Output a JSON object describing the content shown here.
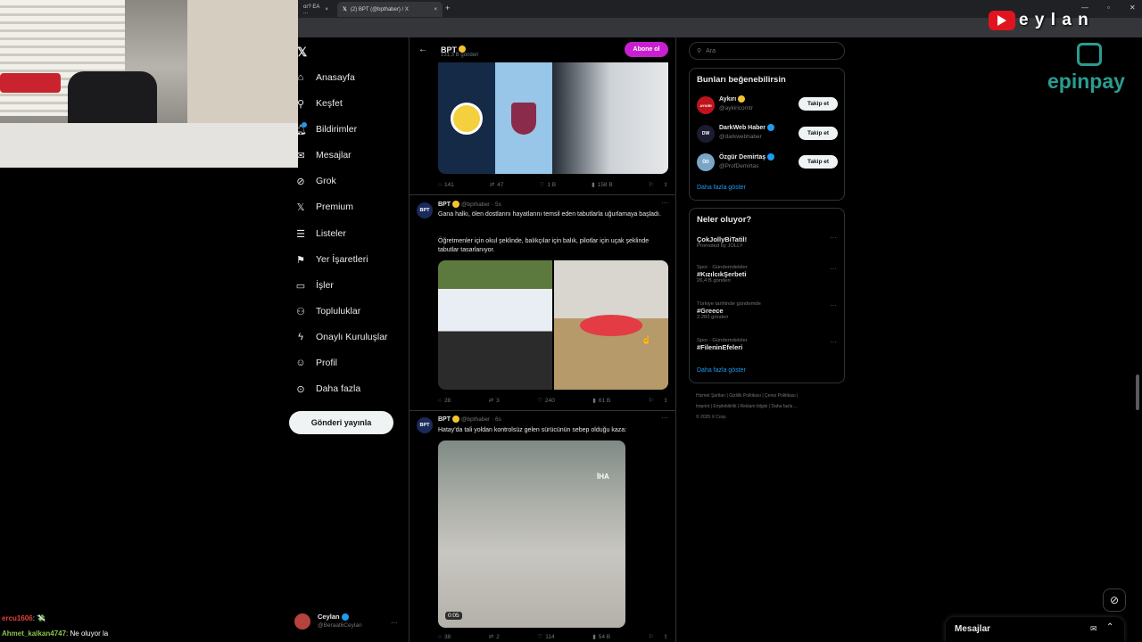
{
  "browser": {
    "tabs": [
      {
        "label": "or? EA ..."
      },
      {
        "label": "(2) BPT (@bpthaber) / X"
      }
    ],
    "new_tab": "+"
  },
  "streamer_brand": {
    "letters": "e y l a n"
  },
  "sponsor": {
    "name": "epinpay"
  },
  "nav": {
    "items": [
      {
        "label": "Anasayfa",
        "icon": "home-icon"
      },
      {
        "label": "Keşfet",
        "icon": "search-icon"
      },
      {
        "label": "Bildirimler",
        "icon": "bell-icon"
      },
      {
        "label": "Mesajlar",
        "icon": "mail-icon"
      },
      {
        "label": "Grok",
        "icon": "grok-icon"
      },
      {
        "label": "Premium",
        "icon": "x-logo-icon"
      },
      {
        "label": "Listeler",
        "icon": "list-icon"
      },
      {
        "label": "Yer İşaretleri",
        "icon": "bookmark-icon"
      },
      {
        "label": "İşler",
        "icon": "briefcase-icon"
      },
      {
        "label": "Topluluklar",
        "icon": "people-icon"
      },
      {
        "label": "Onaylı Kuruluşlar",
        "icon": "lightning-icon"
      },
      {
        "label": "Profil",
        "icon": "person-icon"
      },
      {
        "label": "Daha fazla",
        "icon": "more-circle-icon"
      }
    ],
    "post_button": "Gönderi yayınla",
    "account": {
      "name": "Ceylan",
      "handle": "@Beraat6Ceylan",
      "more": "..."
    }
  },
  "profile_header": {
    "name": "BPT",
    "posts": "131,3 B gönderi",
    "subscribe": "Abone ol"
  },
  "tweets": [
    {
      "stats": {
        "replies": "141",
        "reposts": "47",
        "likes": "1 B",
        "views": "158 B"
      }
    },
    {
      "name": "BPT",
      "handle": "@bpthaber · 5s",
      "avatar": "BPT",
      "text1": "Gana halkı, ölen dostlarını hayatlarını temsil eden tabutlarla uğurlamaya başladı.",
      "text2": "Öğretmenler için okul şeklinde, balıkçılar için balık, pilotlar için uçak şeklinde tabutlar tasarlanıyor.",
      "stats": {
        "replies": "28",
        "reposts": "3",
        "likes": "240",
        "views": "61 B"
      }
    },
    {
      "name": "BPT",
      "handle": "@bpthaber · 6s",
      "avatar": "BPT",
      "text1": "Hatay'da tali yoldan kontrolsüz gelen sürücünün sebep olduğu kaza:",
      "video_watermark": "İHA",
      "video_time": "0:05",
      "stats": {
        "replies": "38",
        "reposts": "2",
        "likes": "114",
        "views": "54 B"
      }
    }
  ],
  "search": {
    "placeholder": "Ara"
  },
  "who_to_follow": {
    "title": "Bunları beğenebilirsin",
    "follow_label": "Takip et",
    "users": [
      {
        "name": "Aykırı",
        "handle": "@aykiricomtr",
        "avatar": "AYKIRI"
      },
      {
        "name": "DarkWeb Haber",
        "handle": "@darkwebhaber",
        "avatar": "DW"
      },
      {
        "name": "Özgür Demirtaş",
        "handle": "@ProfDemirtas",
        "avatar": "ÖD"
      }
    ],
    "show_more": "Daha fazla göster"
  },
  "trends": {
    "title": "Neler oluyor?",
    "items": [
      {
        "meta": "",
        "name": "ÇokJollyBiTatil!",
        "sub": "Promoted by JOLLY"
      },
      {
        "meta": "Spor · Gündemdekiler",
        "name": "#KızılcıkŞerbeti",
        "sub": "26,4 B gönderi"
      },
      {
        "meta": "Türkiye tarihinde gündemde",
        "name": "#Greece",
        "sub": "2.283 gönderi"
      },
      {
        "meta": "Spor · Gündemdekiler",
        "name": "#FileninEfeleri",
        "sub": ""
      }
    ],
    "show_more": "Daha fazla göster"
  },
  "footer": {
    "line1": "Hizmet Şartları | Gizlilik Politikası | Çerez Politikası |",
    "line2": "Imprint | Erişilebilirlik | Reklam bilgisi | Daha fazla ...",
    "line3": "© 2025 X Corp."
  },
  "messages_drawer": {
    "title": "Mesajlar"
  },
  "chat": [
    {
      "user": "ercu1606",
      "text": ": 💸"
    },
    {
      "user": "Ahmet_kalkan4747",
      "text": ": Ne oluyor la"
    }
  ]
}
